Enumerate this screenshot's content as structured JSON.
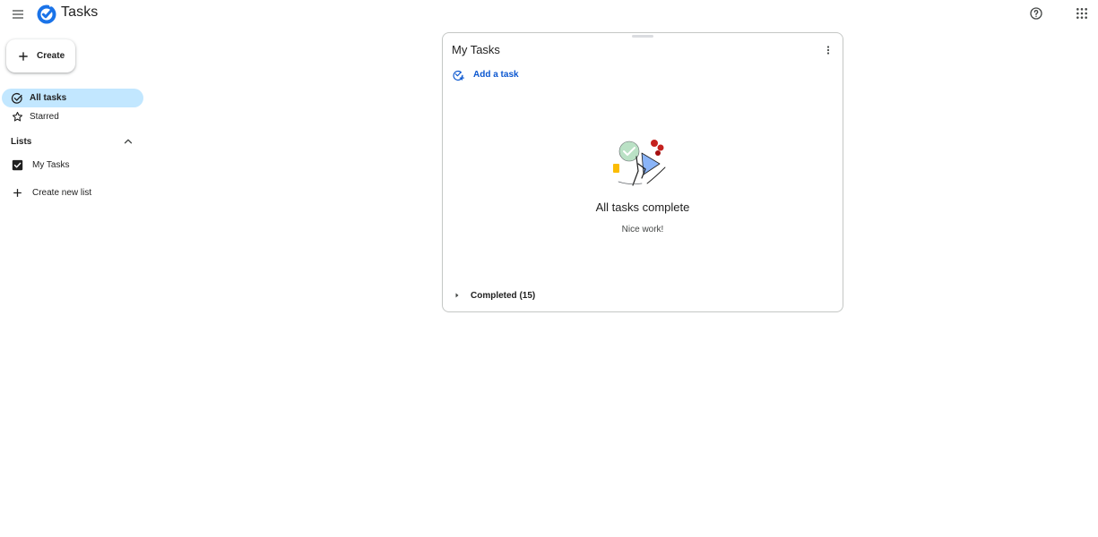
{
  "header": {
    "app_title": "Tasks",
    "menu_icon": "hamburger-menu-icon",
    "logo_icon": "tasks-logo-icon",
    "help_icon": "help-circle-icon",
    "apps_icon": "apps-grid-icon"
  },
  "sidebar": {
    "create_label": "Create",
    "nav": [
      {
        "label": "All tasks",
        "icon": "check-circle-icon",
        "active": true
      },
      {
        "label": "Starred",
        "icon": "star-outline-icon",
        "active": false
      }
    ],
    "lists_heading": "Lists",
    "lists": [
      {
        "label": "My Tasks",
        "checked": true
      }
    ],
    "create_list_label": "Create new list"
  },
  "main": {
    "list_title": "My Tasks",
    "add_task_label": "Add a task",
    "empty_title": "All tasks complete",
    "empty_subtitle": "Nice work!",
    "completed_label": "Completed (15)"
  },
  "colors": {
    "accent": "#0b57d0",
    "active_nav_bg": "#c2e7ff",
    "logo_blue": "#1a73e8"
  }
}
